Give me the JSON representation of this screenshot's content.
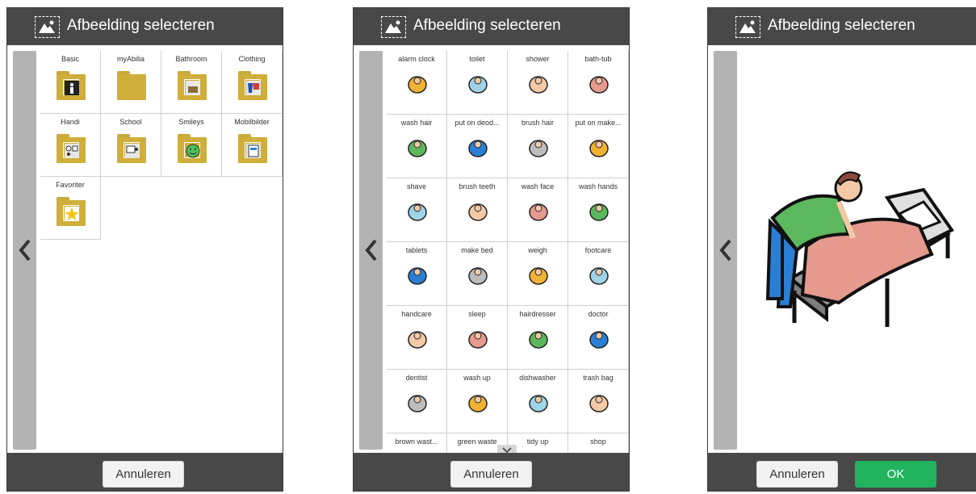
{
  "app": {
    "title": "Afbeelding selecteren"
  },
  "footer": {
    "cancel_label": "Annuleren",
    "ok_label": "OK"
  },
  "folders": [
    {
      "label": "Basic",
      "icon": "person-icon"
    },
    {
      "label": "myAbilia",
      "icon": "folder-icon"
    },
    {
      "label": "Bathroom",
      "icon": "bathroom-icon"
    },
    {
      "label": "Clothing",
      "icon": "clothing-icon"
    },
    {
      "label": "Handi",
      "icon": "handi-icon"
    },
    {
      "label": "School",
      "icon": "school-icon"
    },
    {
      "label": "Smileys",
      "icon": "smiley-icon"
    },
    {
      "label": "Mobilbilder",
      "icon": "mobile-icon"
    },
    {
      "label": "Favoriter",
      "icon": "star-icon"
    }
  ],
  "pictograms": [
    "alarm clock",
    "toilet",
    "shower",
    "bath-tub",
    "wash hair",
    "put on deod...",
    "brush hair",
    "put on make...",
    "shave",
    "brush teeth",
    "wash face",
    "wash hands",
    "tablets",
    "make bed",
    "weigh",
    "footcare",
    "handcare",
    "sleep",
    "hairdresser",
    "doctor",
    "dentist",
    "wash up",
    "dishwasher",
    "trash bag",
    "brown wast...",
    "green waste",
    "tidy up",
    "shop"
  ],
  "colors": {
    "header": "#484848",
    "folder": "#cfae3a",
    "ok": "#21b35e",
    "sidebar": "#b3b3b3"
  }
}
